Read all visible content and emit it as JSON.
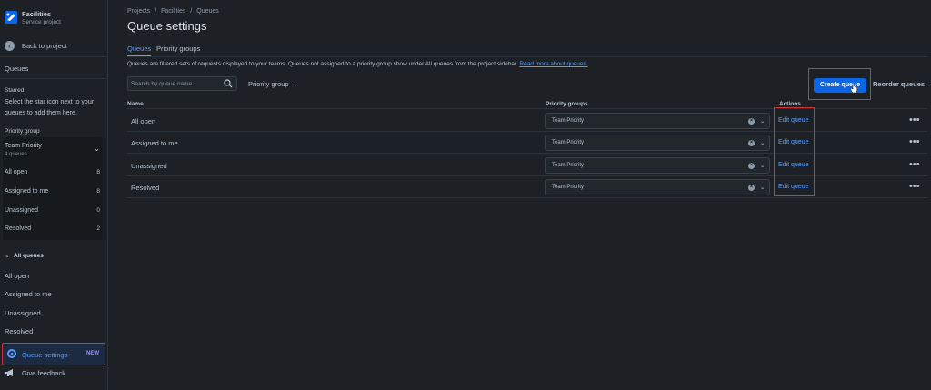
{
  "sidebar": {
    "project_name": "Facilities",
    "project_type": "Service project",
    "back_label": "Back to project",
    "queues_heading": "Queues",
    "starred_heading": "Starred",
    "starred_desc": "Select the star icon next to your queues to add them here.",
    "priority_group_heading": "Priority group",
    "priority_group": {
      "title": "Team Priority",
      "subtitle": "4 queues",
      "items": [
        {
          "label": "All open",
          "count": "8"
        },
        {
          "label": "Assigned to me",
          "count": "8"
        },
        {
          "label": "Unassigned",
          "count": "0"
        },
        {
          "label": "Resolved",
          "count": "2"
        }
      ]
    },
    "all_queues_heading": "All queues",
    "all_queues": [
      "All open",
      "Assigned to me",
      "Unassigned",
      "Resolved"
    ],
    "queue_settings_label": "Queue settings",
    "queue_settings_badge": "NEW",
    "feedback_label": "Give feedback"
  },
  "main": {
    "breadcrumb": [
      "Projects",
      "/",
      "Facilities",
      "/",
      "Queues"
    ],
    "title": "Queue settings",
    "tabs": [
      {
        "label": "Queues",
        "active": true
      },
      {
        "label": "Priority groups",
        "active": false
      }
    ],
    "description": "Queues are filtered sets of requests displayed to your teams. Queues not assigned to a priority group show under All queues from the project sidebar.",
    "description_link": "Read more about queues.",
    "search_placeholder": "Search by queue name",
    "filter_label": "Priority group",
    "create_button": "Create queue",
    "reorder_button": "Reorder queues",
    "columns": {
      "name": "Name",
      "priority_groups": "Priority groups",
      "actions": "Actions"
    },
    "rows": [
      {
        "name": "All open",
        "group": "Team Priority",
        "action": "Edit queue"
      },
      {
        "name": "Assigned to me",
        "group": "Team Priority",
        "action": "Edit queue"
      },
      {
        "name": "Unassigned",
        "group": "Team Priority",
        "action": "Edit queue"
      },
      {
        "name": "Resolved",
        "group": "Team Priority",
        "action": "Edit queue"
      }
    ]
  },
  "colors": {
    "background": "#1d2125",
    "accent": "#579dff",
    "primary_button": "#0c66e4",
    "highlight_border": "#c9373f"
  }
}
